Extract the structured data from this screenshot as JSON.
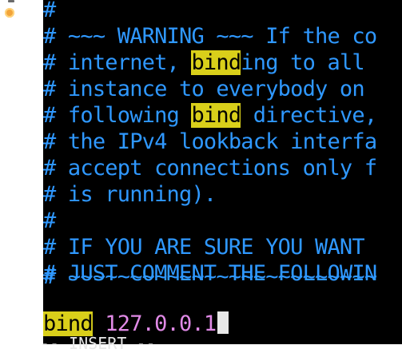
{
  "editor": {
    "lines": [
      {
        "pre": "#",
        "hl": "",
        "post": ""
      },
      {
        "pre": "# ~~~ WARNING ~~~ If the co",
        "hl": "",
        "post": ""
      },
      {
        "pre": "# internet, ",
        "hl": "bind",
        "post": "ing to all"
      },
      {
        "pre": "# instance to everybody on",
        "hl": "",
        "post": ""
      },
      {
        "pre": "# following ",
        "hl": "bind",
        "post": " directive,"
      },
      {
        "pre": "# the IPv4 lookback interfa",
        "hl": "",
        "post": ""
      },
      {
        "pre": "# accept connections only f",
        "hl": "",
        "post": ""
      },
      {
        "pre": "# is running).",
        "hl": "",
        "post": ""
      },
      {
        "pre": "#",
        "hl": "",
        "post": ""
      },
      {
        "pre": "# IF YOU ARE SURE YOU WANT",
        "hl": "",
        "post": ""
      },
      {
        "pre": "# JUST COMMENT THE FOLLOWIN",
        "hl": "",
        "post": ""
      },
      {
        "pre": "# ~~~~~~~~~~~~~~~~~~~~~~~~~",
        "hl": "",
        "post": ""
      }
    ],
    "command": {
      "keyword": "bind",
      "value": " 127.0.0.1"
    },
    "mode_text": "-- INSERT --"
  },
  "colors": {
    "comment": "#2f98ff",
    "highlight": "#d9cf1a",
    "value": "#e08ae6"
  }
}
